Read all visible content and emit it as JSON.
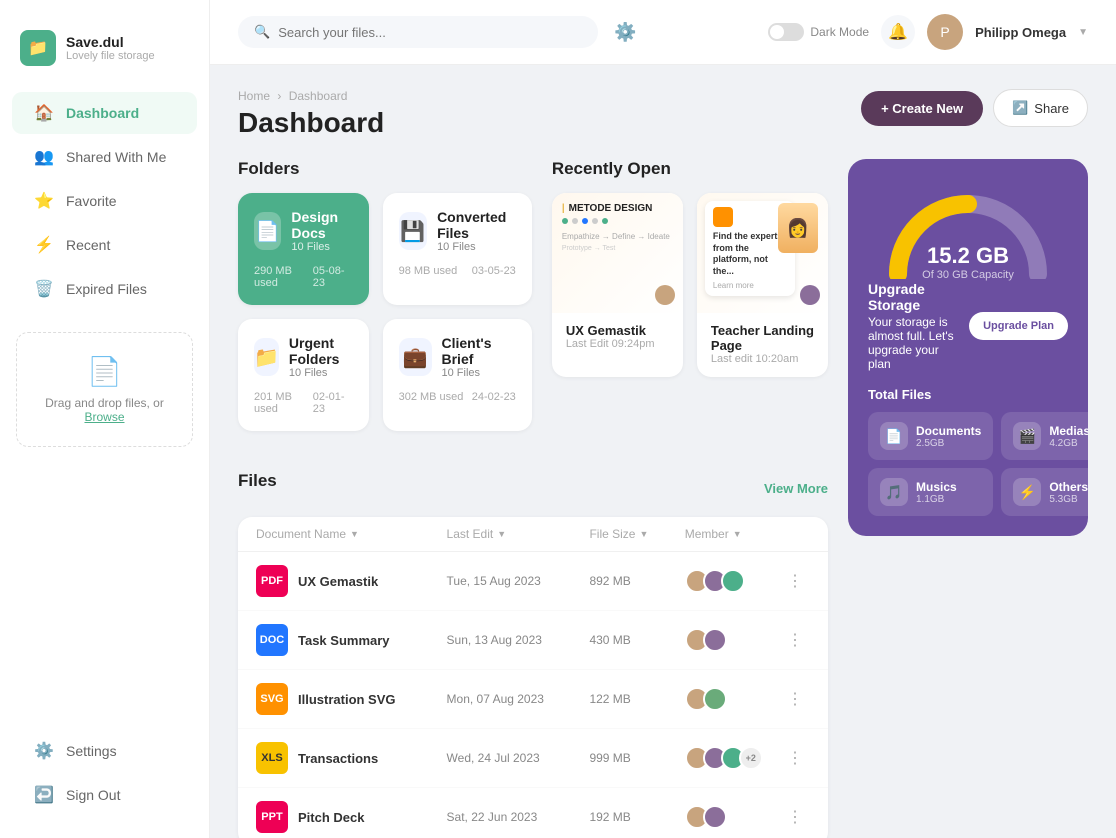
{
  "app": {
    "name": "Save.dul",
    "tagline": "Lovely file storage",
    "logo_emoji": "📁"
  },
  "sidebar": {
    "nav_items": [
      {
        "id": "dashboard",
        "label": "Dashboard",
        "icon": "🏠",
        "active": true
      },
      {
        "id": "shared",
        "label": "Shared With Me",
        "icon": "👥",
        "active": false
      },
      {
        "id": "favorite",
        "label": "Favorite",
        "icon": "⭐",
        "active": false
      },
      {
        "id": "recent",
        "label": "Recent",
        "icon": "⚡",
        "active": false
      },
      {
        "id": "expired",
        "label": "Expired Files",
        "icon": "🗑️",
        "active": false
      }
    ],
    "bottom_nav": [
      {
        "id": "settings",
        "label": "Settings",
        "icon": "⚙️"
      },
      {
        "id": "signout",
        "label": "Sign Out",
        "icon": "↩️"
      }
    ],
    "dropzone": {
      "text": "Drag and drop files, or ",
      "link_text": "Browse",
      "icon": "📄"
    }
  },
  "header": {
    "search_placeholder": "Search your files...",
    "dark_mode_label": "Dark Mode",
    "user_name": "Philipp Omega",
    "filter_icon": "⚙️"
  },
  "breadcrumb": {
    "home": "Home",
    "current": "Dashboard"
  },
  "page": {
    "title": "Dashboard",
    "actions": {
      "create": "+ Create New",
      "share": "Share"
    }
  },
  "folders": {
    "section_title": "Folders",
    "items": [
      {
        "name": "Design Docs",
        "count": "10 Files",
        "used": "290 MB used",
        "date": "05-08-23",
        "active": true,
        "icon": "📄"
      },
      {
        "name": "Converted Files",
        "count": "10 Files",
        "used": "98 MB used",
        "date": "03-05-23",
        "active": false,
        "icon": "💾"
      },
      {
        "name": "Urgent Folders",
        "count": "10 Files",
        "used": "201 MB used",
        "date": "02-01-23",
        "active": false,
        "icon": "📁"
      },
      {
        "name": "Client's Brief",
        "count": "10 Files",
        "used": "302 MB used",
        "date": "24-02-23",
        "active": false,
        "icon": "💼"
      }
    ]
  },
  "recently_open": {
    "section_title": "Recently Open",
    "items": [
      {
        "name": "UX Gemastik",
        "last_edit": "Last Edit  09:24pm",
        "avatar_color": "#c8a47e"
      },
      {
        "name": "Teacher Landing Page",
        "last_edit": "Last edit 10:20am",
        "avatar_color": "#8b6e9a"
      }
    ]
  },
  "files": {
    "section_title": "Files",
    "view_more": "View More",
    "columns": {
      "name": "Document Name",
      "last_edit": "Last Edit",
      "file_size": "File Size",
      "member": "Member"
    },
    "rows": [
      {
        "name": "UX Gemastik",
        "type": "PDF",
        "type_class": "type-pdf",
        "last_edit": "Tue, 15 Aug 2023",
        "size": "892 MB",
        "avatars": [
          "#c8a47e",
          "#8b6e9a",
          "#4caf8a"
        ],
        "extra_count": ""
      },
      {
        "name": "Task Summary",
        "type": "DOC",
        "type_class": "type-doc",
        "last_edit": "Sun, 13 Aug 2023",
        "size": "430 MB",
        "avatars": [
          "#c8a47e",
          "#8b6e9a"
        ],
        "extra_count": ""
      },
      {
        "name": "Illustration SVG",
        "type": "SVG",
        "type_class": "type-svg",
        "last_edit": "Mon, 07 Aug 2023",
        "size": "122 MB",
        "avatars": [
          "#c8a47e",
          "#6aab7a"
        ],
        "extra_count": ""
      },
      {
        "name": "Transactions",
        "type": "XLS",
        "type_class": "type-xls",
        "last_edit": "Wed, 24 Jul 2023",
        "size": "999 MB",
        "avatars": [
          "#c8a47e",
          "#8b6e9a",
          "#4caf8a"
        ],
        "extra_count": "+2"
      },
      {
        "name": "Pitch Deck",
        "type": "PPT",
        "type_class": "type-ppt",
        "last_edit": "Sat, 22 Jun 2023",
        "size": "192 MB",
        "avatars": [
          "#c8a47e",
          "#8b6e9a"
        ],
        "extra_count": ""
      }
    ]
  },
  "storage": {
    "used_gb": "15.2 GB",
    "capacity": "Of 30 GB Capacity",
    "upgrade_title": "Upgrade Storage",
    "upgrade_desc": "Your storage is almost full. Let's upgrade your plan",
    "upgrade_btn": "Upgrade Plan",
    "total_files_title": "Total Files",
    "gauge_used_pct": 50,
    "file_types": [
      {
        "name": "Documents",
        "size": "2.5GB",
        "icon": "📄",
        "color": "#5b8dee"
      },
      {
        "name": "Medias",
        "size": "4.2GB",
        "icon": "🎬",
        "color": "#a06ee8"
      },
      {
        "name": "Musics",
        "size": "1.1GB",
        "icon": "🎵",
        "color": "#5b8dee"
      },
      {
        "name": "Others",
        "size": "5.3GB",
        "icon": "⚡",
        "color": "#a06ee8"
      }
    ]
  }
}
